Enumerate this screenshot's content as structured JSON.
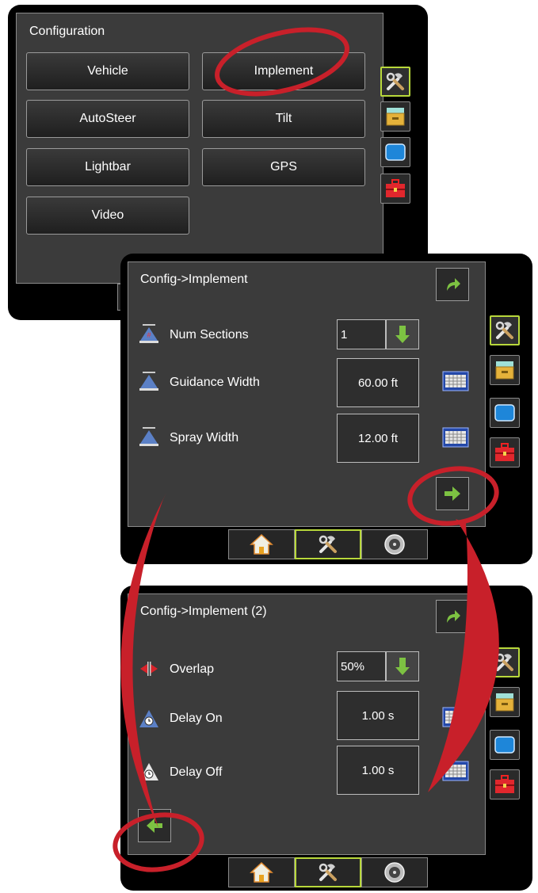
{
  "screen1": {
    "title": "Configuration",
    "buttons": [
      "Vehicle",
      "Implement",
      "AutoSteer",
      "Tilt",
      "Lightbar",
      "GPS",
      "Video"
    ]
  },
  "screen2": {
    "title": "Config->Implement",
    "num_sections": {
      "label": "Num Sections",
      "value": "1"
    },
    "guidance_width": {
      "label": "Guidance Width",
      "value": "60.00 ft"
    },
    "spray_width": {
      "label": "Spray Width",
      "value": "12.00 ft"
    }
  },
  "screen3": {
    "title": "Config->Implement (2)",
    "overlap": {
      "label": "Overlap",
      "value": "50%"
    },
    "delay_on": {
      "label": "Delay On",
      "value": "1.00 s"
    },
    "delay_off": {
      "label": "Delay Off",
      "value": "1.00 s"
    }
  },
  "icons": {
    "side": [
      "tools-icon",
      "data-icon",
      "display-icon",
      "toolbox-icon"
    ],
    "bottom": [
      "home-icon",
      "tools-icon",
      "gauge-icon"
    ]
  },
  "colors": {
    "accent": "#b8d83b",
    "highlight": "#c8202a",
    "arrow": "#7dc242"
  }
}
